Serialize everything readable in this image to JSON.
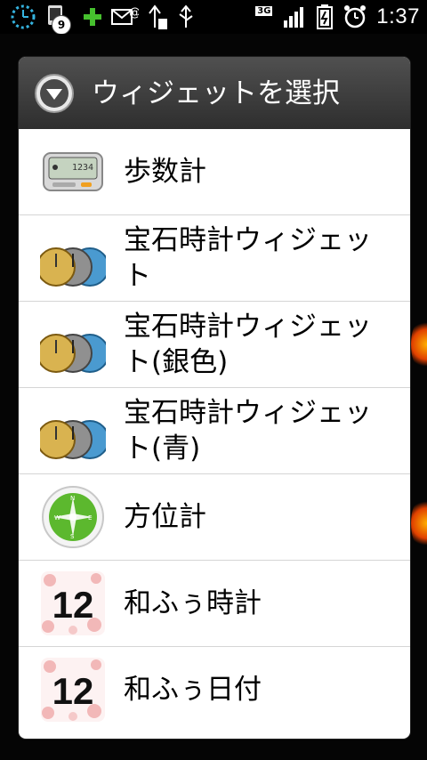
{
  "status_bar": {
    "time": "1:37",
    "notification_count": "9",
    "network_type": "3G",
    "icons": [
      "clock-icon",
      "notification-icon",
      "plus-icon",
      "mail-icon",
      "usb-debug-icon",
      "usb-icon",
      "signal-icon",
      "battery-icon",
      "alarm-icon"
    ]
  },
  "dialog": {
    "title": "ウィジェットを選択",
    "header_icon": "dropdown-circle-icon",
    "items": [
      {
        "label": "歩数計",
        "icon": "pedometer-icon"
      },
      {
        "label": "宝石時計ウィジェット",
        "icon": "jewel-clocks-icon"
      },
      {
        "label": "宝石時計ウィジェット(銀色)",
        "icon": "jewel-clocks-icon"
      },
      {
        "label": "宝石時計ウィジェット(青)",
        "icon": "jewel-clocks-icon"
      },
      {
        "label": "方位計",
        "icon": "compass-icon"
      },
      {
        "label": "和ふぅ時計",
        "icon": "wafuu-clock-icon",
        "tile_text": "12"
      },
      {
        "label": "和ふぅ日付",
        "icon": "wafuu-date-icon",
        "tile_text": "12"
      }
    ]
  },
  "colors": {
    "header_bg": "#3a3a3a",
    "dialog_bg": "#ffffff",
    "divider": "#d5d5d5",
    "compass_green": "#5cb82e"
  }
}
